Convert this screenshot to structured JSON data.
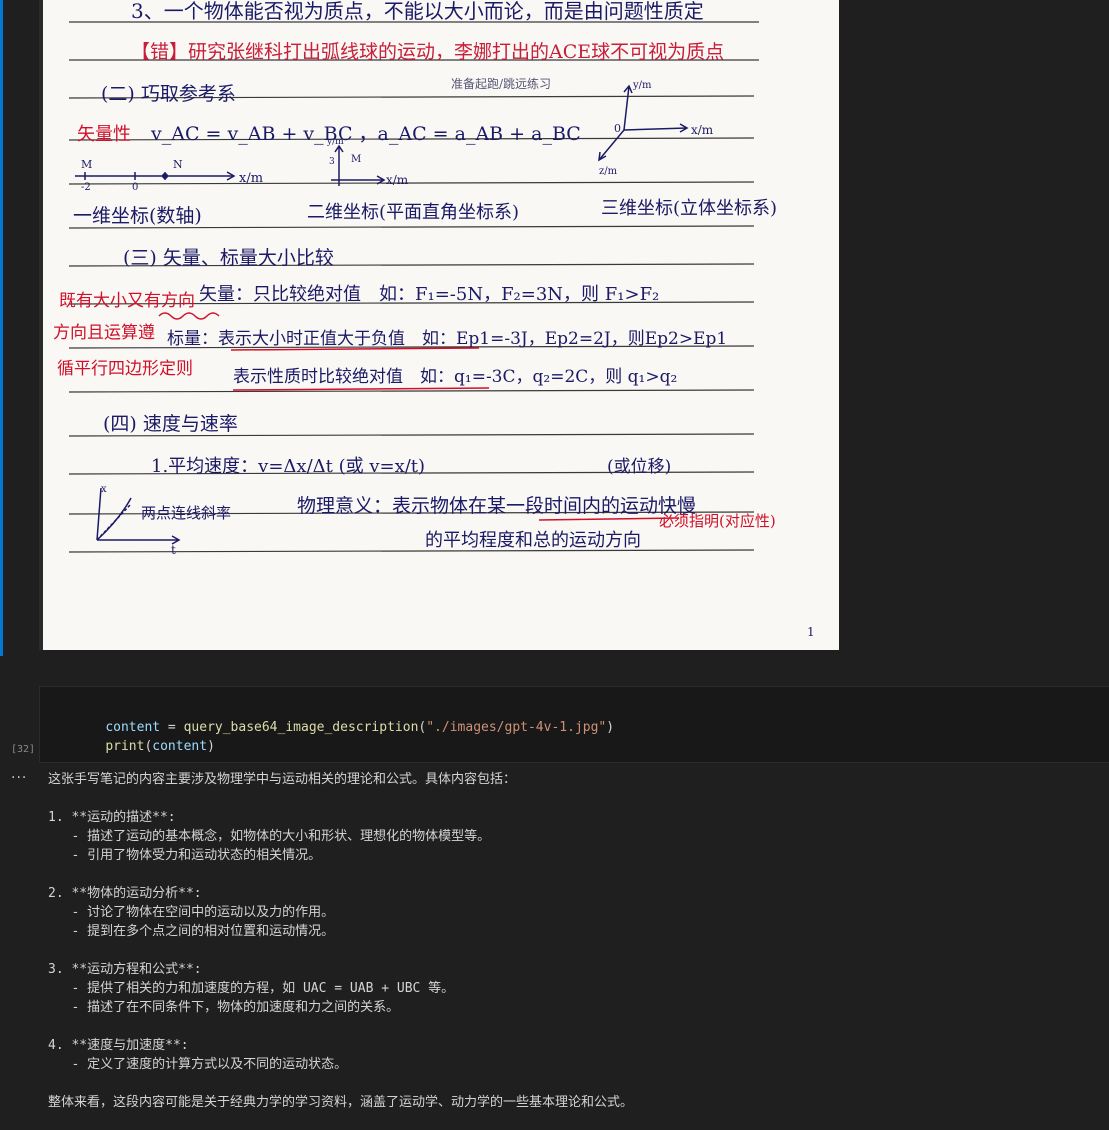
{
  "notes_image": {
    "lines": [
      {
        "text": "3、一个物体能否视为质点，不能以大小而论，而是由问题性质定",
        "color": "#1a1a66"
      },
      {
        "text": "【错】研究张继科打出弧线球的运动，李娜打出的ACE球不可视为质点",
        "color": "#c81e3a"
      },
      {
        "text": "(二) 巧取参考系",
        "color": "#1a1a66"
      },
      {
        "text": "矢量性",
        "color": "#d0102a"
      },
      {
        "text": "v_AC = v_AB + v_BC ，a_AC = a_AB + a_BC",
        "color": "#1a1a66"
      },
      {
        "text": "一维坐标(数轴)",
        "color": "#1a1a66"
      },
      {
        "text": "二维坐标(平面直角坐标系)",
        "color": "#1a1a66"
      },
      {
        "text": "三维坐标(立体坐标系)",
        "color": "#1a1a66"
      },
      {
        "text": "(三) 矢量、标量大小比较",
        "color": "#1a1a66"
      },
      {
        "text": "既有大小又有方向",
        "color": "#d0102a"
      },
      {
        "text": "矢量：只比较绝对值　如：F₁=-5N，F₂=3N，则 F₁>F₂",
        "color": "#1a1a66"
      },
      {
        "text": "方向且运算遵",
        "color": "#d0102a"
      },
      {
        "text": "标量：表示大小时正值大于负值　如：Ep1=-3J，Ep2=2J，则Ep2>Ep1",
        "color": "#1a1a66"
      },
      {
        "text": "循平行四边形定则",
        "color": "#d0102a"
      },
      {
        "text": "表示性质时比较绝对值　如：q₁=-3C，q₂=2C，则 q₁>q₂",
        "color": "#1a1a66"
      },
      {
        "text": "(四) 速度与速率",
        "color": "#1a1a66"
      },
      {
        "text": "1.平均速度：v=Δx/Δt (或 v=x/t)",
        "color": "#1a1a66"
      },
      {
        "text": "(或位移)",
        "color": "#1a1a66"
      },
      {
        "text": "两点连线斜率",
        "color": "#1a1a66"
      },
      {
        "text": "物理意义：表示物体在某一段时间内的运动快慢",
        "color": "#1a1a66"
      },
      {
        "text": "必须指明(对应性)",
        "color": "#d0102a"
      },
      {
        "text": "的平均程度和总的运动方向",
        "color": "#1a1a66"
      }
    ],
    "small_notes": {
      "axis_x": "x/m",
      "axis_y": "y/m",
      "axis_z": "z/m",
      "point_m": "M",
      "point_n": "N",
      "origin": "0",
      "neg_two": "-2",
      "three": "3",
      "one": "1",
      "graph_t": "t",
      "graph_x": "x",
      "faint_note": "准备起跑/跳远练习"
    }
  },
  "code_cell": {
    "exec_count": "[32]",
    "line1": {
      "var": "content",
      "op": " = ",
      "fn": "query_base64_image_description",
      "open": "(",
      "str": "\"./images/gpt-4v-1.jpg\"",
      "close": ")"
    },
    "line2": {
      "fn": "print",
      "open": "(",
      "var": "content",
      "close": ")"
    }
  },
  "output": {
    "ellipsis": "···",
    "lines": [
      "这张手写笔记的内容主要涉及物理学中与运动相关的理论和公式。具体内容包括：",
      "",
      "1. **运动的描述**:",
      "   - 描述了运动的基本概念，如物体的大小和形状、理想化的物体模型等。",
      "   - 引用了物体受力和运动状态的相关情况。",
      "",
      "2. **物体的运动分析**:",
      "   - 讨论了物体在空间中的运动以及力的作用。",
      "   - 提到在多个点之间的相对位置和运动情况。",
      "",
      "3. **运动方程和公式**:",
      "   - 提供了相关的力和加速度的方程，如 UAC = UAB + UBC 等。",
      "   - 描述了在不同条件下，物体的加速度和力之间的关系。",
      "",
      "4. **速度与加速度**:",
      "   - 定义了速度的计算方式以及不同的运动状态。",
      "",
      "整体来看，这段内容可能是关于经典力学的学习资料，涵盖了运动学、动力学的一些基本理论和公式。"
    ]
  }
}
